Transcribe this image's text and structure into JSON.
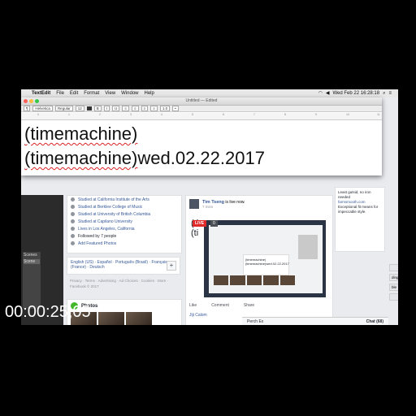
{
  "menubar": {
    "app": "TextEdit",
    "items": [
      "File",
      "Edit",
      "Format",
      "View",
      "Window",
      "Help"
    ],
    "clock": "Wed Feb 22  16:28:18"
  },
  "textedit": {
    "title": "Untitled — Edited",
    "font_family_box": "Helvetica",
    "font_style_box": "Regular",
    "font_size_box": "12",
    "ruler_ticks": [
      "0",
      "1",
      "2",
      "3",
      "4",
      "5",
      "6",
      "7",
      "8",
      "9",
      "10",
      "11"
    ],
    "lines": [
      "(timemachine)",
      "(timemachine)wed.02.22.2017"
    ]
  },
  "facebook": {
    "intro_items": [
      "Studied at California Institute of the Arts",
      "Studied at Berklee College of Music",
      "Studied at University of British Columbia",
      "Studied at Capilano University",
      "Lives in Los Angeles, California",
      "Followed by 7 people"
    ],
    "add_featured": "Add Featured Photos",
    "languages": "English (US) · Español · Português (Brasil) · Français (France) · Deutsch",
    "footer": "Privacy · Terms · Advertising · Ad Choices · Cookies · More · Facebook © 2017",
    "photos_label": "Photos",
    "post_name": "Tim Tseng",
    "post_status": "is live now.",
    "post_time": "7 mins",
    "post_big": [
      "(ti",
      "(ti"
    ],
    "live_badge": "LIVE",
    "views_badge": "0",
    "inner_lines": [
      "(timemachine)",
      "(timemachine)wed.02.22.2017"
    ],
    "actions": [
      "Like",
      "Comment",
      "Share"
    ],
    "comment_by": "Jiji Calom",
    "right_col": [
      "Least gutsid, no iron needed",
      "farmsmooth.com",
      "Exceptional fit means for impeccable style."
    ],
    "right_buttons": [
      "",
      "ding",
      "ble",
      ""
    ],
    "chat_perch": "Perch Ex",
    "chat_label": "Chat (68)",
    "scenes_label": "Scenes",
    "scene_item": "Scene"
  },
  "overlay": {
    "timecode": "00:00:25;05"
  }
}
